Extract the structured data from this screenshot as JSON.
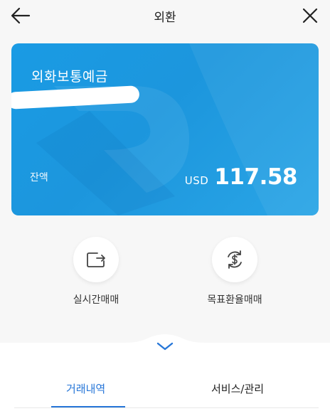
{
  "header": {
    "title": "외환",
    "back_icon": "arrow-left-icon",
    "close_icon": "close-icon"
  },
  "card": {
    "account_name": "외화보통예금",
    "balance_label": "잔액",
    "currency": "USD",
    "amount": "117.58",
    "color": "#1c97df"
  },
  "actions": [
    {
      "label": "실시간매매",
      "icon": "exchange-icon"
    },
    {
      "label": "목표환율매매",
      "icon": "dollar-cycle-icon"
    }
  ],
  "tabs": [
    {
      "label": "거래내역",
      "active": true
    },
    {
      "label": "서비스/관리",
      "active": false
    }
  ],
  "colors": {
    "accent": "#2676d8",
    "card": "#1c97df",
    "background": "#f7f7f7"
  }
}
